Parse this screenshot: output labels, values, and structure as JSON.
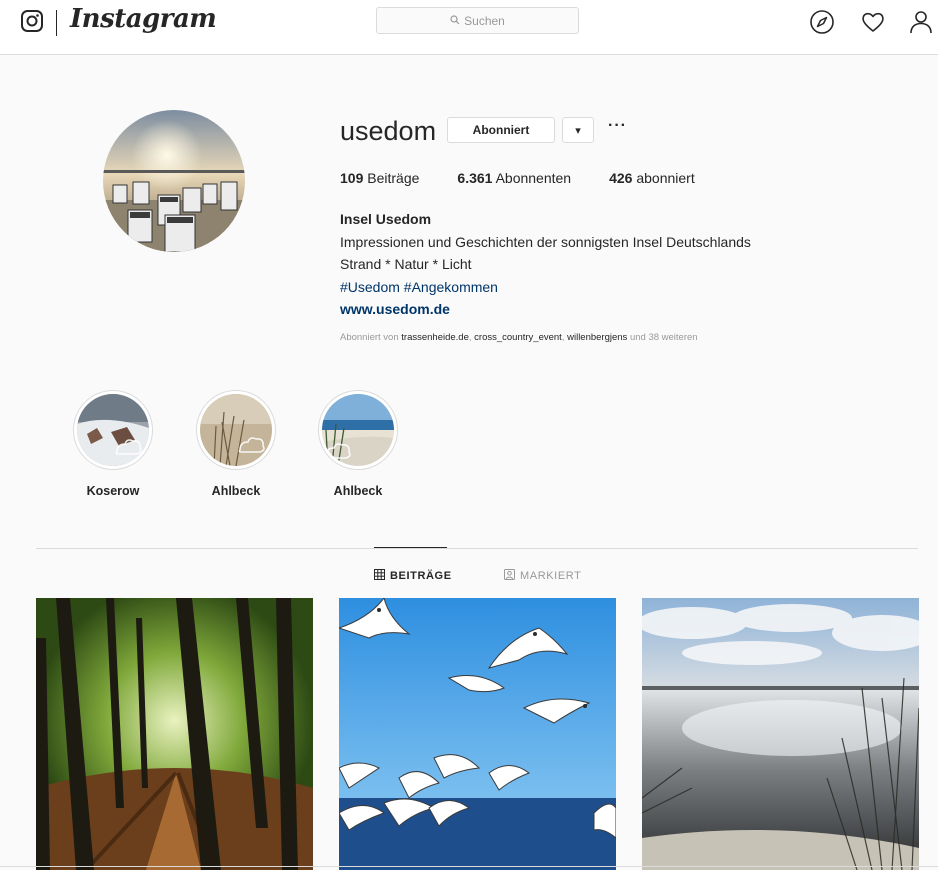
{
  "nav": {
    "app_name": "Instagram",
    "search_placeholder": "Suchen"
  },
  "profile": {
    "username": "usedom",
    "follow_button_label": "Abonniert",
    "dropdown_arrow": "▾",
    "more_options": "···",
    "stats": [
      {
        "count": "109",
        "label": "Beiträge"
      },
      {
        "count": "6.361",
        "label": "Abonnenten"
      },
      {
        "count": "426",
        "label": "abonniert"
      }
    ],
    "bio": {
      "name": "Insel Usedom",
      "line1": "Impressionen und Geschichten der sonnigsten Insel Deutschlands",
      "line2": "Strand * Natur * Licht",
      "hashtags": "#Usedom #Angekommen",
      "website": "www.usedom.de"
    },
    "followed_by": {
      "prefix": "Abonniert von",
      "accounts": [
        "trassenheide.de",
        "cross_country_event",
        "willenbergjens"
      ],
      "suffix": "und 38 weiteren"
    }
  },
  "highlights": [
    {
      "label": "Koserow"
    },
    {
      "label": "Ahlbeck"
    },
    {
      "label": "Ahlbeck"
    }
  ],
  "tabs": [
    {
      "label": "BEITRÄGE",
      "active": true,
      "icon": "grid-icon"
    },
    {
      "label": "MARKIERT",
      "active": false,
      "icon": "tagged-icon"
    }
  ],
  "colors": {
    "link": "#003569",
    "border": "#dbdbdb",
    "text": "#262626",
    "muted": "#999999"
  }
}
